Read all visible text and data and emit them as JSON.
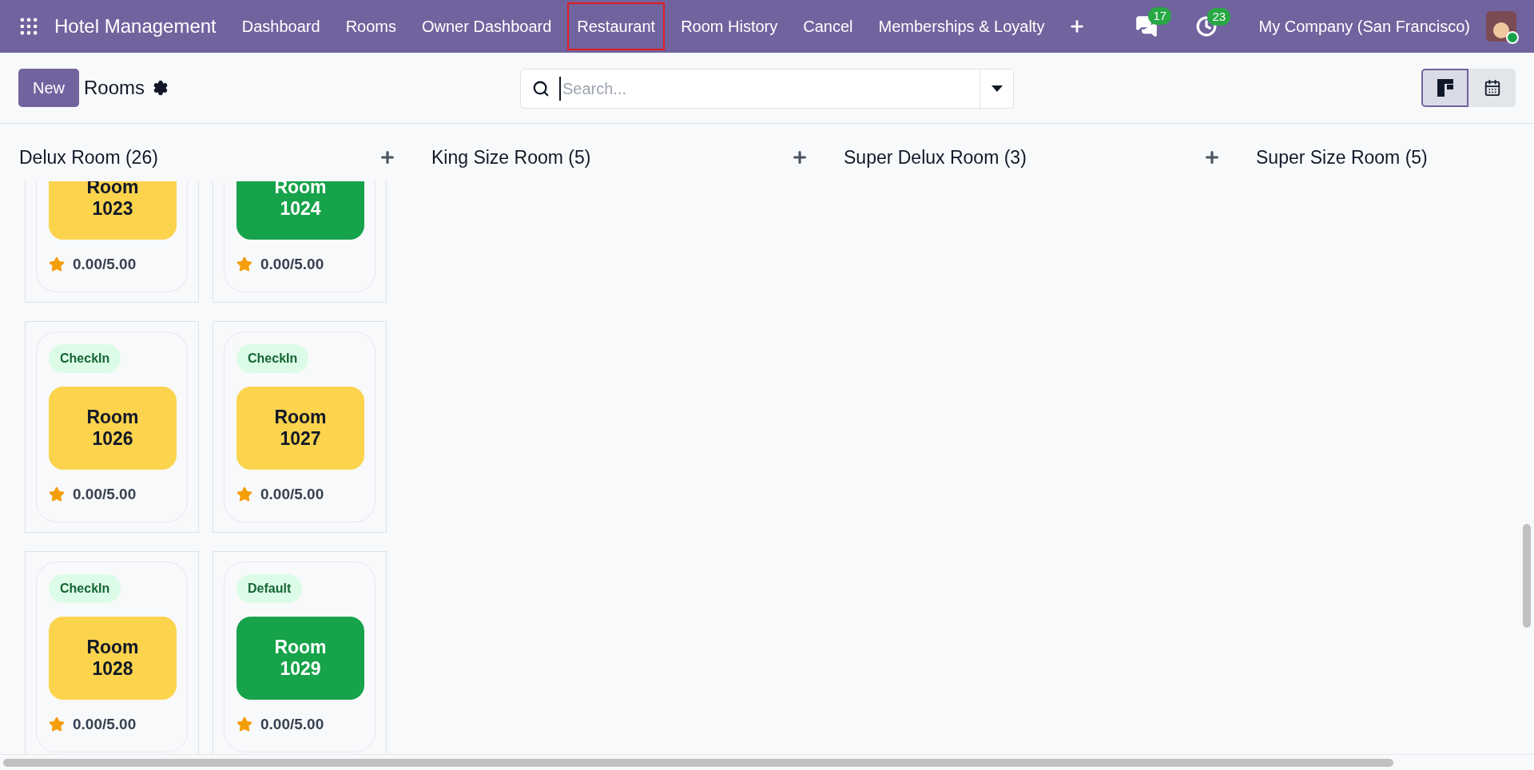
{
  "navbar": {
    "app_title": "Hotel Management",
    "menu": [
      {
        "label": "Dashboard",
        "highlighted": false
      },
      {
        "label": "Rooms",
        "highlighted": false
      },
      {
        "label": "Owner Dashboard",
        "highlighted": false
      },
      {
        "label": "Restaurant",
        "highlighted": true
      },
      {
        "label": "Room History",
        "highlighted": false
      },
      {
        "label": "Cancel",
        "highlighted": false
      },
      {
        "label": "Memberships & Loyalty",
        "highlighted": false
      }
    ],
    "messages_count": "17",
    "activities_count": "23",
    "company": "My Company (San Francisco)",
    "user_online": true
  },
  "control_panel": {
    "new_button": "New",
    "title": "Rooms",
    "search": {
      "placeholder": "Search..."
    },
    "views": [
      {
        "kind": "kanban",
        "selected": true
      },
      {
        "kind": "calendar",
        "selected": false
      }
    ]
  },
  "columns": [
    {
      "title": "Delux Room (26)",
      "add_button": true,
      "cards": [
        {
          "room": "Room 1023",
          "color": "#fcd34d",
          "rating": "0.00/5.00"
        },
        {
          "room": "Room 1024",
          "color": "#16a34a",
          "rating": "0.00/5.00"
        },
        {
          "status": "CheckIn",
          "room": "Room 1026",
          "color": "#fcd34d",
          "rating": "0.00/5.00"
        },
        {
          "status": "CheckIn",
          "room": "Room 1027",
          "color": "#fcd34d",
          "rating": "0.00/5.00"
        },
        {
          "status": "CheckIn",
          "room": "Room 1028",
          "color": "#fcd34d",
          "rating": "0.00/5.00"
        },
        {
          "status": "Default",
          "room": "Room 1029",
          "color": "#16a34a",
          "rating": "0.00/5.00"
        }
      ]
    },
    {
      "title": "King Size Room (5)",
      "add_button": true
    },
    {
      "title": "Super Delux Room (3)",
      "add_button": true
    },
    {
      "title": "Super Size Room (5)"
    }
  ]
}
